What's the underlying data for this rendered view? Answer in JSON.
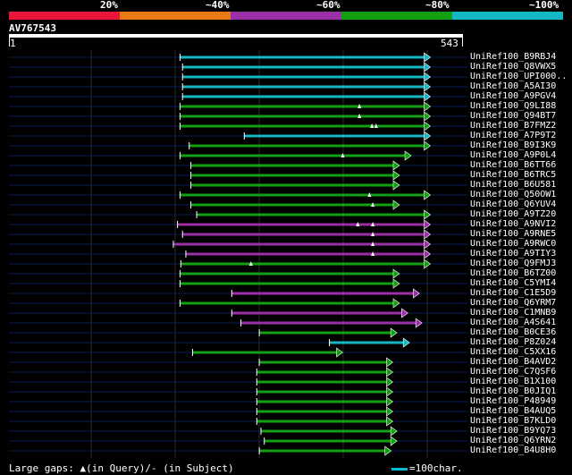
{
  "scale": {
    "labels": [
      "20%",
      "~40%",
      "~60%",
      "~80%",
      "~100%"
    ],
    "colors": [
      "#e8173a",
      "#e97a13",
      "#9b2fa8",
      "#12a012",
      "#14b8c4"
    ]
  },
  "query": {
    "name": "AV767543",
    "start": "1",
    "end": "543",
    "length": 543
  },
  "legend": {
    "large_gaps": "Large gaps: ",
    "in_query": "(in Query)/- (in Subject)",
    "bar_note": "=100char."
  },
  "hits": [
    {
      "name": "UniRef100_B9RBJ4",
      "color": "#14b8c4",
      "start": 205,
      "end": 505,
      "gaps": []
    },
    {
      "name": "UniRef100_Q8VWX5",
      "color": "#14b8c4",
      "start": 208,
      "end": 505,
      "gaps": []
    },
    {
      "name": "UniRef100_UPI000..",
      "color": "#14b8c4",
      "start": 208,
      "end": 505,
      "gaps": []
    },
    {
      "name": "UniRef100_A5AI30",
      "color": "#14b8c4",
      "start": 208,
      "end": 505,
      "gaps": []
    },
    {
      "name": "UniRef100_A9PGV4",
      "color": "#14b8c4",
      "start": 208,
      "end": 505,
      "gaps": []
    },
    {
      "name": "UniRef100_Q9LI88",
      "color": "#12a012",
      "start": 205,
      "end": 505,
      "gaps": [
        420
      ]
    },
    {
      "name": "UniRef100_Q94BT7",
      "color": "#12a012",
      "start": 205,
      "end": 505,
      "gaps": [
        420
      ]
    },
    {
      "name": "UniRef100_B7FMZ2",
      "color": "#12a012",
      "start": 205,
      "end": 505,
      "gaps": [
        435,
        440
      ]
    },
    {
      "name": "UniRef100_A7P9T2",
      "color": "#14b8c4",
      "start": 282,
      "end": 505,
      "gaps": []
    },
    {
      "name": "UniRef100_B9I3K9",
      "color": "#12a012",
      "start": 216,
      "end": 505,
      "gaps": []
    },
    {
      "name": "UniRef100_A9P0L4",
      "color": "#12a012",
      "start": 205,
      "end": 482,
      "gaps": [
        400
      ]
    },
    {
      "name": "UniRef100_B6TT66",
      "color": "#12a012",
      "start": 218,
      "end": 468,
      "gaps": []
    },
    {
      "name": "UniRef100_B6TRC5",
      "color": "#12a012",
      "start": 218,
      "end": 468,
      "gaps": []
    },
    {
      "name": "UniRef100_B6U581",
      "color": "#12a012",
      "start": 218,
      "end": 468,
      "gaps": []
    },
    {
      "name": "UniRef100_Q50OW1",
      "color": "#12a012",
      "start": 205,
      "end": 505,
      "gaps": [
        432
      ]
    },
    {
      "name": "UniRef100_Q6YUV4",
      "color": "#12a012",
      "start": 218,
      "end": 468,
      "gaps": [
        436
      ]
    },
    {
      "name": "UniRef100_A9TZ20",
      "color": "#12a012",
      "start": 225,
      "end": 505,
      "gaps": []
    },
    {
      "name": "UniRef100_A9NVI2",
      "color": "#9b2fa8",
      "start": 202,
      "end": 505,
      "gaps": [
        418,
        436
      ]
    },
    {
      "name": "UniRef100_A9RNE5",
      "color": "#9b2fa8",
      "start": 208,
      "end": 505,
      "gaps": [
        436
      ]
    },
    {
      "name": "UniRef100_A9RWC0",
      "color": "#9b2fa8",
      "start": 197,
      "end": 505,
      "gaps": [
        436
      ]
    },
    {
      "name": "UniRef100_A9TIY3",
      "color": "#9b2fa8",
      "start": 212,
      "end": 505,
      "gaps": [
        436
      ]
    },
    {
      "name": "UniRef100_Q9FMJ3",
      "color": "#12a012",
      "start": 206,
      "end": 505,
      "gaps": [
        290
      ]
    },
    {
      "name": "UniRef100_B6TZ00",
      "color": "#12a012",
      "start": 205,
      "end": 468,
      "gaps": []
    },
    {
      "name": "UniRef100_C5YMI4",
      "color": "#12a012",
      "start": 205,
      "end": 468,
      "gaps": []
    },
    {
      "name": "UniRef100_C1E5D9",
      "color": "#9b2fa8",
      "start": 267,
      "end": 492,
      "gaps": []
    },
    {
      "name": "UniRef100_Q6YRM7",
      "color": "#12a012",
      "start": 205,
      "end": 468,
      "gaps": []
    },
    {
      "name": "UniRef100_C1MNB9",
      "color": "#9b2fa8",
      "start": 267,
      "end": 478,
      "gaps": []
    },
    {
      "name": "UniRef100_A4S641",
      "color": "#9b2fa8",
      "start": 278,
      "end": 495,
      "gaps": []
    },
    {
      "name": "UniRef100_B0CE36",
      "color": "#12a012",
      "start": 300,
      "end": 465,
      "gaps": []
    },
    {
      "name": "UniRef100_P8Z024",
      "color": "#14b8c4",
      "start": 384,
      "end": 480,
      "gaps": []
    },
    {
      "name": "UniRef100_C5XX16",
      "color": "#12a012",
      "start": 220,
      "end": 400,
      "gaps": []
    },
    {
      "name": "UniRef100_B4AVD2",
      "color": "#12a012",
      "start": 300,
      "end": 460,
      "gaps": []
    },
    {
      "name": "UniRef100_C7QSF6",
      "color": "#12a012",
      "start": 297,
      "end": 460,
      "gaps": []
    },
    {
      "name": "UniRef100_B1X100",
      "color": "#12a012",
      "start": 297,
      "end": 460,
      "gaps": []
    },
    {
      "name": "UniRef100_B0JIQ1",
      "color": "#12a012",
      "start": 297,
      "end": 460,
      "gaps": []
    },
    {
      "name": "UniRef100_P48949",
      "color": "#12a012",
      "start": 297,
      "end": 460,
      "gaps": []
    },
    {
      "name": "UniRef100_B4AUQ5",
      "color": "#12a012",
      "start": 297,
      "end": 460,
      "gaps": []
    },
    {
      "name": "UniRef100_B7KLD0",
      "color": "#12a012",
      "start": 297,
      "end": 460,
      "gaps": []
    },
    {
      "name": "UniRef100_B9YQ73",
      "color": "#12a012",
      "start": 302,
      "end": 465,
      "gaps": []
    },
    {
      "name": "UniRef100_Q6YRN2",
      "color": "#12a012",
      "start": 306,
      "end": 465,
      "gaps": []
    },
    {
      "name": "UniRef100_B4U8H0",
      "color": "#12a012",
      "start": 300,
      "end": 458,
      "gaps": []
    }
  ]
}
